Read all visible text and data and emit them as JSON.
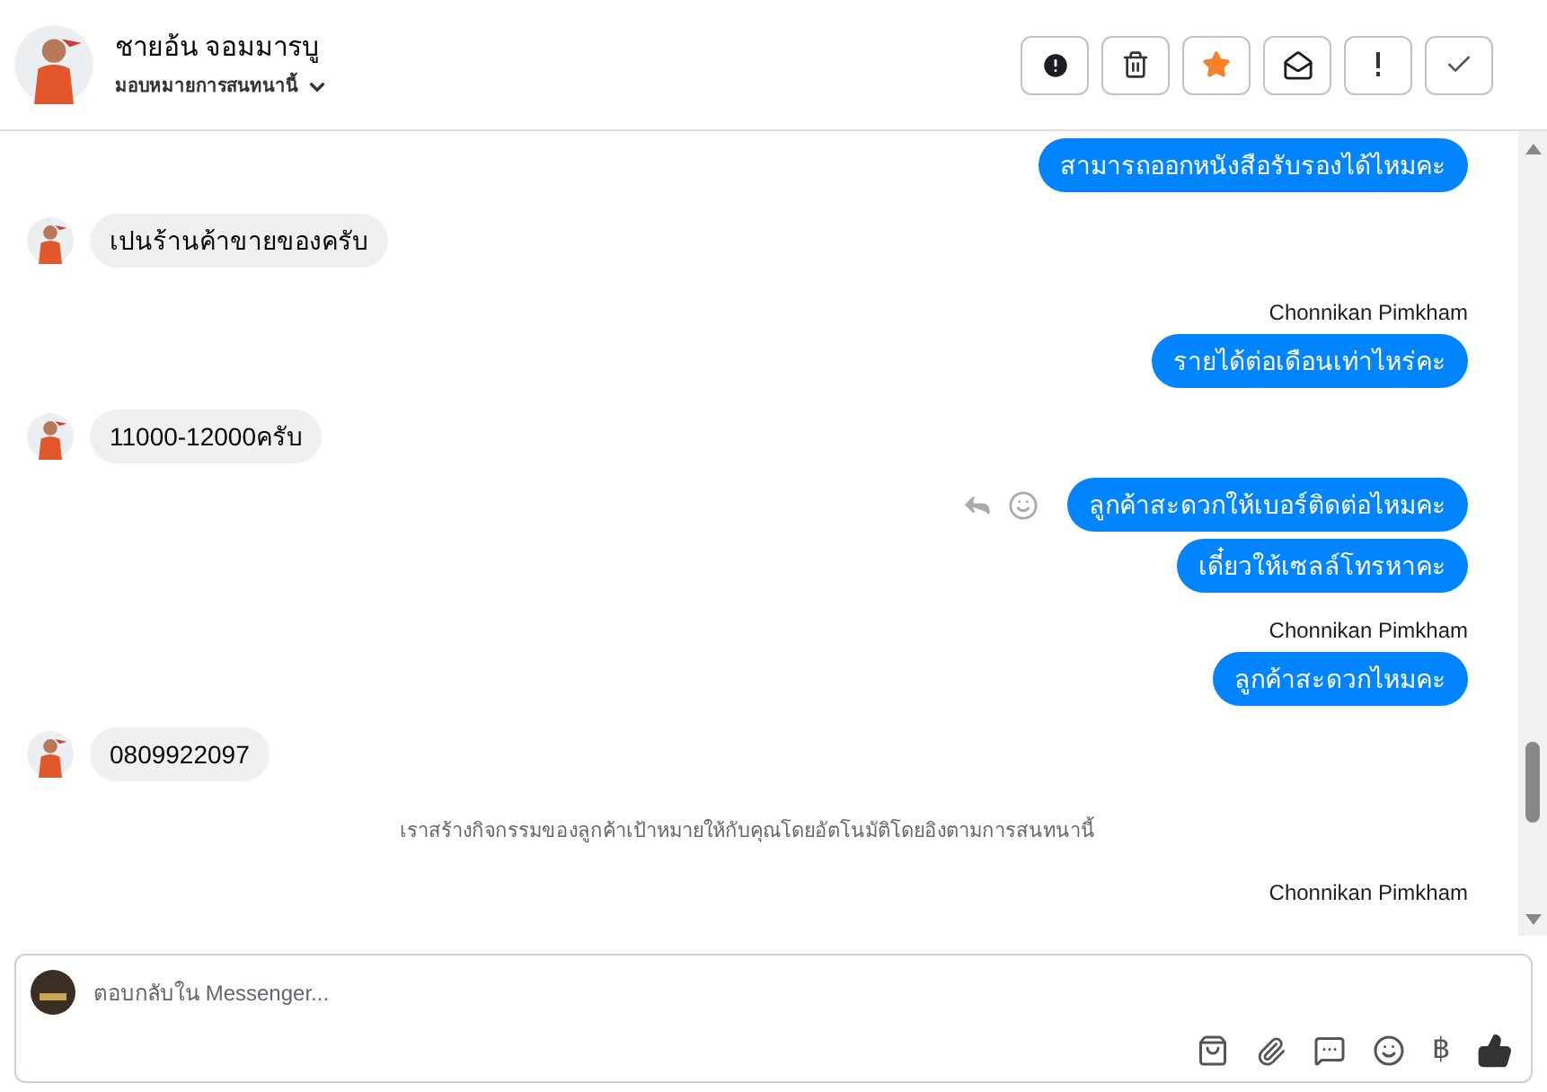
{
  "header": {
    "name": "ชายอ้น จอมมารบู",
    "assign_label": "มอบหมายการสนทนานี้"
  },
  "toolbar": [
    {
      "kind": "alert"
    },
    {
      "kind": "trash"
    },
    {
      "kind": "star"
    },
    {
      "kind": "mail"
    },
    {
      "kind": "exclaim"
    },
    {
      "kind": "check"
    }
  ],
  "messages": [
    {
      "kind": "outgoing",
      "text": "สามารถออกหนังสือรับรองได้ไหมคะ",
      "hover_actions": false
    },
    {
      "kind": "incoming",
      "text": "เปนร้านค้าขายของครับ"
    },
    {
      "kind": "outgoing",
      "sender": "Chonnikan Pimkham",
      "text": "รายได้ต่อเดือนเท่าไหร่คะ",
      "hover_actions": false
    },
    {
      "kind": "incoming",
      "text": "11000-12000ครับ"
    },
    {
      "kind": "outgoing",
      "text": "ลูกค้าสะดวกให้เบอร์ติดต่อไหมคะ",
      "hover_actions": true
    },
    {
      "kind": "outgoing",
      "text": "เดี๋ยวให้เซลล์โทรหาคะ",
      "hover_actions": false
    },
    {
      "kind": "outgoing",
      "sender": "Chonnikan Pimkham",
      "text": "ลูกค้าสะดวกไหมคะ",
      "hover_actions": false
    },
    {
      "kind": "incoming",
      "text": "0809922097"
    },
    {
      "kind": "notice",
      "text": "เราสร้างกิจกรรมของลูกค้าเป้าหมายให้กับคุณโดยอัตโนมัติโดยอิงตามการสนทนานี้"
    },
    {
      "kind": "sender",
      "text": "Chonnikan Pimkham"
    }
  ],
  "composer": {
    "placeholder": "ตอบกลับใน Messenger...",
    "currency_symbol": "฿"
  }
}
